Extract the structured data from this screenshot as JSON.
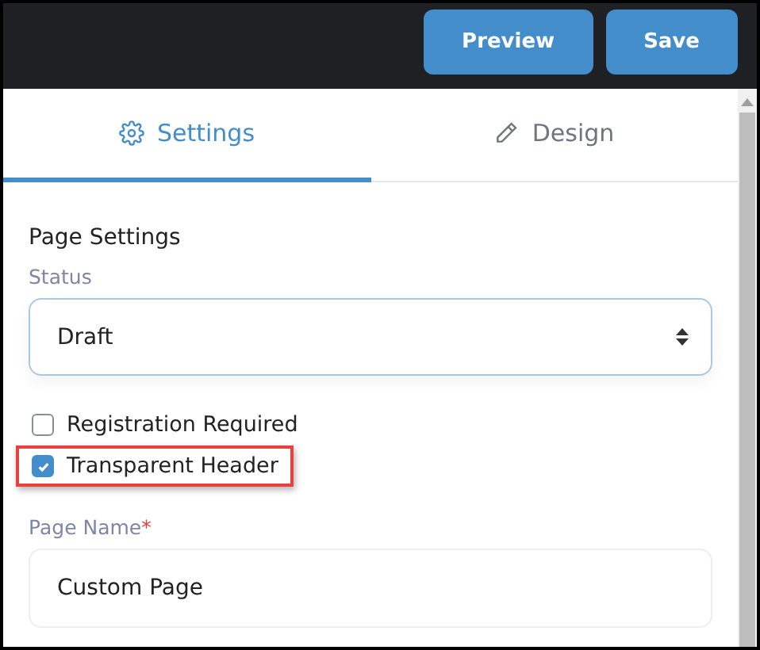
{
  "header": {
    "buttons": [
      {
        "label": "Preview"
      },
      {
        "label": "Save"
      }
    ]
  },
  "tabs": [
    {
      "label": "Settings",
      "selected": true
    },
    {
      "label": "Design",
      "selected": false
    }
  ],
  "section_title": "Page Settings",
  "status": {
    "label": "Status",
    "value": "Draft"
  },
  "checkboxes": [
    {
      "label": "Registration Required",
      "checked": false,
      "highlighted": false
    },
    {
      "label": "Transparent Header",
      "checked": true,
      "highlighted": true
    }
  ],
  "page_name": {
    "label": "Page Name",
    "required_mark": "*",
    "value": "Custom Page"
  }
}
